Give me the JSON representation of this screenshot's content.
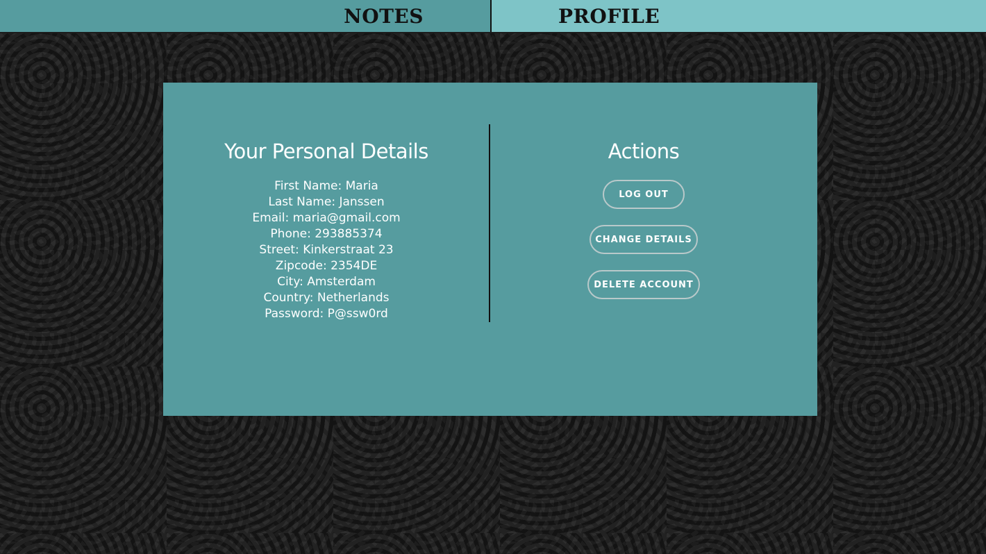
{
  "nav": {
    "tabs": [
      {
        "label": "NOTES"
      },
      {
        "label": "PROFILE"
      }
    ]
  },
  "details": {
    "title": "Your Personal Details",
    "fields": [
      "First Name: Maria",
      "Last Name: Janssen",
      "Email: maria@gmail.com",
      "Phone: 293885374",
      "Street: Kinkerstraat 23",
      "Zipcode: 2354DE",
      "City: Amsterdam",
      "Country: Netherlands",
      "Password: P@ssw0rd"
    ]
  },
  "actions": {
    "title": "Actions",
    "buttons": [
      {
        "label": "LOG OUT"
      },
      {
        "label": "CHANGE DETAILS"
      },
      {
        "label": "DELETE ACCOUNT"
      }
    ]
  },
  "colors": {
    "nav_active": "#569c9f",
    "nav_inactive": "#7ec4c7",
    "card": "#569c9f",
    "background": "#2b2b2b",
    "text": "#ffffff"
  }
}
